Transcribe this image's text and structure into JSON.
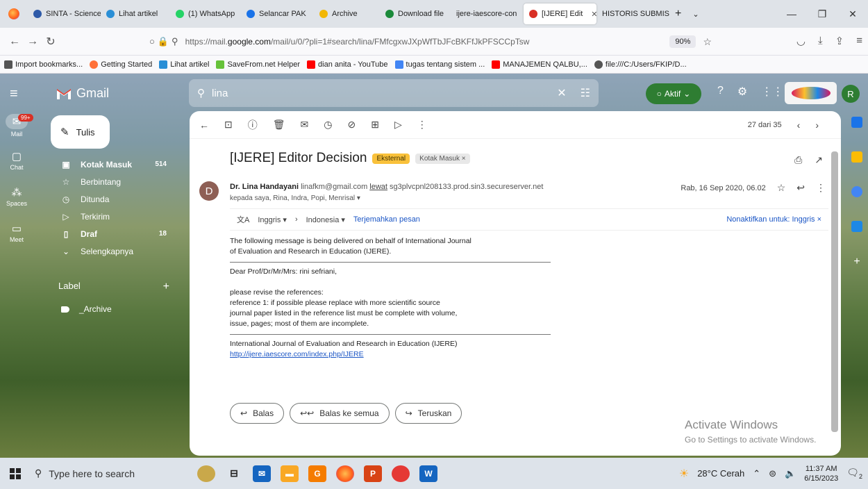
{
  "browser": {
    "tabs": [
      {
        "label": "SINTA - Science ar",
        "color": "#2e5aa8",
        "active": false
      },
      {
        "label": "Lihat artikel",
        "color": "#2a8fd6",
        "active": false
      },
      {
        "label": "(1) WhatsApp",
        "color": "#25d366",
        "active": false
      },
      {
        "label": "Selancar PAK",
        "color": "#1a73e8",
        "active": false
      },
      {
        "label": "Archive",
        "color": "#f2b705",
        "active": false
      },
      {
        "label": "Download file",
        "color": "#1b8a3a",
        "active": false
      },
      {
        "label": "ijere-iaescore-con",
        "color": "#ffffff",
        "active": false
      },
      {
        "label": "[IJERE] Edit",
        "color": "#d93025",
        "active": true
      },
      {
        "label": "HISTORIS SUBMISS",
        "color": "#ffffff",
        "active": false
      }
    ],
    "url_prefix": "https://mail.",
    "url_domain": "google.com",
    "url_suffix": "/mail/u/0/?pli=1#search/lina/FMfcgxwJXpWfTbJFcBKFfJkPFSCCpTsw",
    "zoom": "90%",
    "bookmarks": [
      {
        "label": "Import bookmarks...",
        "color": "#555555"
      },
      {
        "label": "Getting Started",
        "color": "#ff7139"
      },
      {
        "label": "Lihat artikel",
        "color": "#2a8fd6"
      },
      {
        "label": "SaveFrom.net Helper",
        "color": "#67c23a"
      },
      {
        "label": "dian anita - YouTube",
        "color": "#ff0000"
      },
      {
        "label": "tugas tentang sistem ...",
        "color": "#4285f4"
      },
      {
        "label": "MANAJEMEN QALBU,...",
        "color": "#ff0000"
      },
      {
        "label": "file:///C:/Users/FKIP/D...",
        "color": "#555555"
      }
    ]
  },
  "gmail": {
    "app_name": "Gmail",
    "search_query": "lina",
    "status": "Aktif",
    "avatar_letter": "R",
    "rail": [
      {
        "label": "Mail",
        "icon": "mail-icon",
        "badge": "99+"
      },
      {
        "label": "Chat",
        "icon": "chat-icon"
      },
      {
        "label": "Spaces",
        "icon": "spaces-icon"
      },
      {
        "label": "Meet",
        "icon": "meet-icon"
      }
    ],
    "compose_label": "Tulis",
    "nav": [
      {
        "label": "Kotak Masuk",
        "count": "514",
        "bold": true,
        "icon": "inbox-icon"
      },
      {
        "label": "Berbintang",
        "count": "",
        "bold": false,
        "icon": "star-icon"
      },
      {
        "label": "Ditunda",
        "count": "",
        "bold": false,
        "icon": "clock-icon"
      },
      {
        "label": "Terkirim",
        "count": "",
        "bold": false,
        "icon": "send-icon"
      },
      {
        "label": "Draf",
        "count": "18",
        "bold": true,
        "icon": "draft-icon"
      },
      {
        "label": "Selengkapnya",
        "count": "",
        "bold": false,
        "icon": "chevron-down-icon"
      }
    ],
    "label_header": "Label",
    "label_item": "_Archive",
    "pagination": "27 dari 35"
  },
  "email": {
    "subject": "[IJERE] Editor Decision",
    "chip_external": "Eksternal",
    "chip_inbox": "Kotak Masuk",
    "sender_initial": "D",
    "sender_name": "Dr. Lina Handayani",
    "sender_email": "linafkm@gmail.com",
    "via_label": "lewat",
    "via_host": "sg3plvcpnl208133.prod.sin3.secureserver.net",
    "recipients": "kepada saya, Rina, Indra, Popi, Menrisal",
    "date": "Rab, 16 Sep 2020, 06.02",
    "translate_from": "Inggris",
    "translate_to": "Indonesia",
    "translate_link": "Terjemahkan pesan",
    "translate_off": "Nonaktifkan untuk: Inggris",
    "body_line1": "The following message is being delivered on behalf of International Journal",
    "body_line2": "of Evaluation and Research in Education (IJERE).",
    "greeting": "Dear Prof/Dr/Mr/Mrs: rini sefriani,",
    "req1": "please revise the references:",
    "req2": "reference 1: if possible please replace with more scientific source",
    "req3": "journal paper listed in the reference list must be complete with volume,",
    "req4": "issue,  pages; most of them are incomplete.",
    "footer_name": "International Journal of Evaluation and Research in Education (IJERE)",
    "footer_link": "http://ijere.iaescore.com/index.php/IJERE",
    "reply": "Balas",
    "reply_all": "Balas ke semua",
    "forward": "Teruskan"
  },
  "watermark": {
    "line1": "Activate Windows",
    "line2": "Go to Settings to activate Windows."
  },
  "taskbar": {
    "search_placeholder": "Type here to search",
    "weather": "28°C  Cerah",
    "time": "11:37 AM",
    "date": "6/15/2023",
    "notif_count": "2"
  }
}
